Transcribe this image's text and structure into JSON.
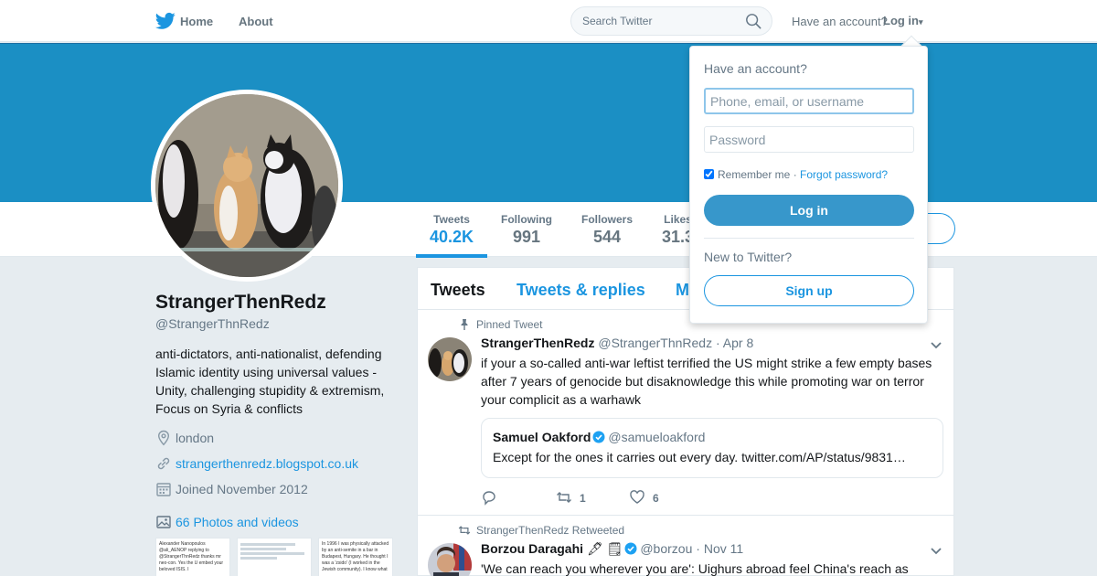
{
  "topnav": {
    "home_label": "Home",
    "about_label": "About",
    "search_placeholder": "Search Twitter",
    "have_account": "Have an account?",
    "login_label": "Log in",
    "login_caret": "▾"
  },
  "colors": {
    "accent": "#1b95e0",
    "banner": "#1b8fc4",
    "text": "#14171a",
    "muted": "#657786"
  },
  "profile": {
    "name": "StrangerThenRedz",
    "handle": "@StrangerThnRedz",
    "bio": "anti-dictators, anti-nationalist, defending Islamic identity using universal values - Unity, challenging stupidity & extremism, Focus on Syria & conflicts",
    "location": "london",
    "website": "strangerthenredz.blogspot.co.uk",
    "joined": "Joined November 2012",
    "photos_link": "66 Photos and videos",
    "thumbnails": [
      "Alexander Nanopoulos @ali_AENOP\nreplying to @StrangerThnRedz\nthanks mr neo-con. Yes the U\nembed your beloved ISIS. I",
      "",
      "In 1996 I was physically attacked by an anti-semite in a bar in Budapest, Hungary. He thought I was a 'zsido' (I worked in the Jewish community). I know what"
    ]
  },
  "stats": [
    {
      "label": "Tweets",
      "value": "40.2K"
    },
    {
      "label": "Following",
      "value": "991"
    },
    {
      "label": "Followers",
      "value": "544"
    },
    {
      "label": "Likes",
      "value": "31.3"
    }
  ],
  "tabs": {
    "tweets": "Tweets",
    "replies": "Tweets & replies",
    "media": "M"
  },
  "tweets": [
    {
      "context": "Pinned Tweet",
      "name": "StrangerThenRedz",
      "handle": "@StrangerThnRedz",
      "dot": "·",
      "date": "Apr 8",
      "text": "if your a so-called anti-war leftist terrified the US might strike a few empty bases after 7 years of genocide but disaknowledge this while promoting war on terror your complicit as a warhawk",
      "quote": {
        "name": "Samuel Oakford",
        "handle": "@samueloakford",
        "text": "Except for the ones it carries out every day. twitter.com/AP/status/9831…"
      },
      "replies": "",
      "retweets": "1",
      "likes": "6"
    },
    {
      "context": "StrangerThenRedz Retweeted",
      "name": "Borzou Daragahi",
      "badges": "🖋 🗒",
      "handle": "@borzou",
      "dot": "·",
      "date": "Nov 11",
      "text": "'We can reach you wherever you are': Uighurs abroad feel China's reach as"
    }
  ],
  "login_dropdown": {
    "title": "Have an account?",
    "username_placeholder": "Phone, email, or username",
    "password_placeholder": "Password",
    "remember_me": "Remember me",
    "separator": "·",
    "forgot_password": "Forgot password?",
    "login_button": "Log in",
    "new_to_twitter": "New to Twitter?",
    "signup_button": "Sign up"
  }
}
